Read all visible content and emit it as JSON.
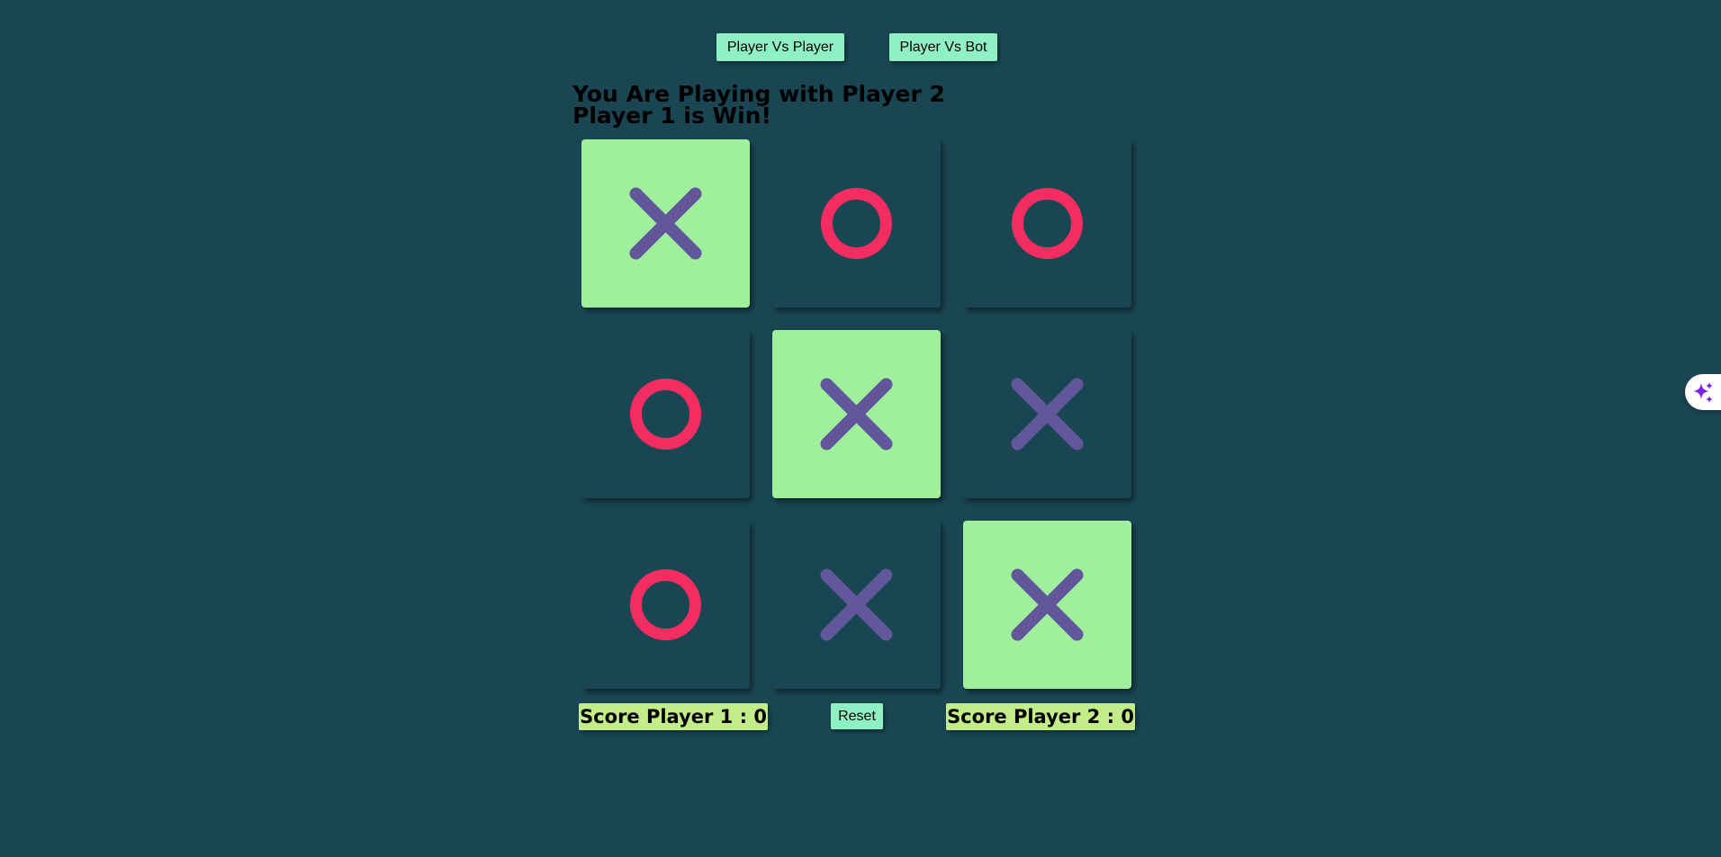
{
  "mode_buttons": {
    "pvp_label": "Player Vs Player",
    "pvb_label": "Player Vs Bot"
  },
  "status": {
    "opponent_line": "You Are Playing with Player 2",
    "result_line": "Player 1 is Win!"
  },
  "board": {
    "cells": [
      {
        "mark": "X",
        "winning": true
      },
      {
        "mark": "O",
        "winning": false
      },
      {
        "mark": "O",
        "winning": false
      },
      {
        "mark": "O",
        "winning": false
      },
      {
        "mark": "X",
        "winning": true
      },
      {
        "mark": "X",
        "winning": false
      },
      {
        "mark": "O",
        "winning": false
      },
      {
        "mark": "X",
        "winning": false
      },
      {
        "mark": "X",
        "winning": true
      }
    ]
  },
  "scores": {
    "player1_label": "Score Player 1 : 0",
    "player2_label": "Score Player 2 : 0"
  },
  "controls": {
    "reset_label": "Reset"
  },
  "side_widget": {
    "icon": "sparkle-icon"
  },
  "colors": {
    "background": "#1a4653",
    "mark_x": "#62579a",
    "mark_o": "#f32d62",
    "win_cell": "#a0ef9c",
    "button": "#8ff0c4",
    "score_badge": "#c2ee8a",
    "sparkle": "#7b1fe0"
  }
}
